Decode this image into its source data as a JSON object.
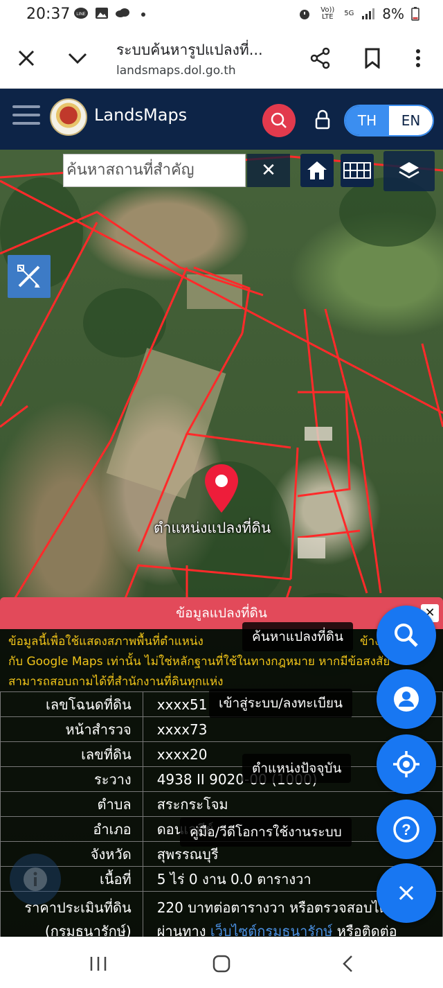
{
  "status": {
    "time": "20:37",
    "volte": "Vo)) LTE",
    "net": "5G",
    "battery": "8%"
  },
  "browser": {
    "title": "ระบบค้นหารูปแปลงที่...",
    "url": "landsmaps.dol.go.th"
  },
  "app": {
    "name": "LandsMaps",
    "lang_th": "TH",
    "lang_en": "EN"
  },
  "map": {
    "search_placeholder": "ค้นหาสถานที่สำคัญ",
    "clear": "✕",
    "pin_label": "ตำแหน่งแปลงที่ดิน"
  },
  "info": {
    "header": "ข้อมูลแปลงที่ดิน",
    "close": "✕",
    "notice_1": "ข้อมูลนี้เพื่อใช้แสดงสภาพพื้นที่ตำแหน่ง",
    "notice_1b": "ข้าง",
    "notice_2": "กับ Google Maps เท่านั้น ไม่ใช่หลักฐานที่ใช้ในทางกฎหมาย หากมีข้อสงสัย",
    "notice_3": "สามารถสอบถามได้ที่สำนักงานที่ดินทุกแห่ง",
    "rows": [
      {
        "k": "เลขโฉนดที่ดิน",
        "v": "xxxx51"
      },
      {
        "k": "หน้าสำรวจ",
        "v": "xxxx73"
      },
      {
        "k": "เลขที่ดิน",
        "v": "xxxx20"
      },
      {
        "k": "ระวาง",
        "v": "4938 II 9020-00 (1000)"
      },
      {
        "k": "ตำบล",
        "v": "สระกระโจม"
      },
      {
        "k": "อำเภอ",
        "v": "ดอนเจดีย์"
      },
      {
        "k": "จังหวัด",
        "v": "สุพรรณบุรี"
      },
      {
        "k": "เนื้อที่",
        "v": "5 ไร่ 0 งาน 0.0 ตารางวา"
      }
    ],
    "price_k1": "ราคาประเมินที่ดิน",
    "price_k2": "(กรมธนารักษ์)",
    "price_v1": "220 บาทต่อตารางวา หรือตรวจสอบได้",
    "price_v2a": "ผ่านทาง ",
    "price_link": "เว็บไซต์กรมธนารักษ์",
    "price_v2b": " หรือติดต่อ"
  },
  "fab": {
    "search_tip": "ค้นหาแปลงที่ดิน",
    "login_tip": "เข้าสู่ระบบ/ลงทะเบียน",
    "location_tip": "ตำแหน่งปัจจุบัน",
    "manual_tip": "คู่มือ/วีดีโอการใช้งานระบบ",
    "help_glyph": "?",
    "close_glyph": "×"
  },
  "colors": {
    "header_bg": "#0d2447",
    "accent": "#1877f2",
    "search_red": "#e23a4d",
    "info_header": "#e24a5a",
    "notice_text": "#f0c419",
    "parcel_line": "#ff2a2a"
  }
}
